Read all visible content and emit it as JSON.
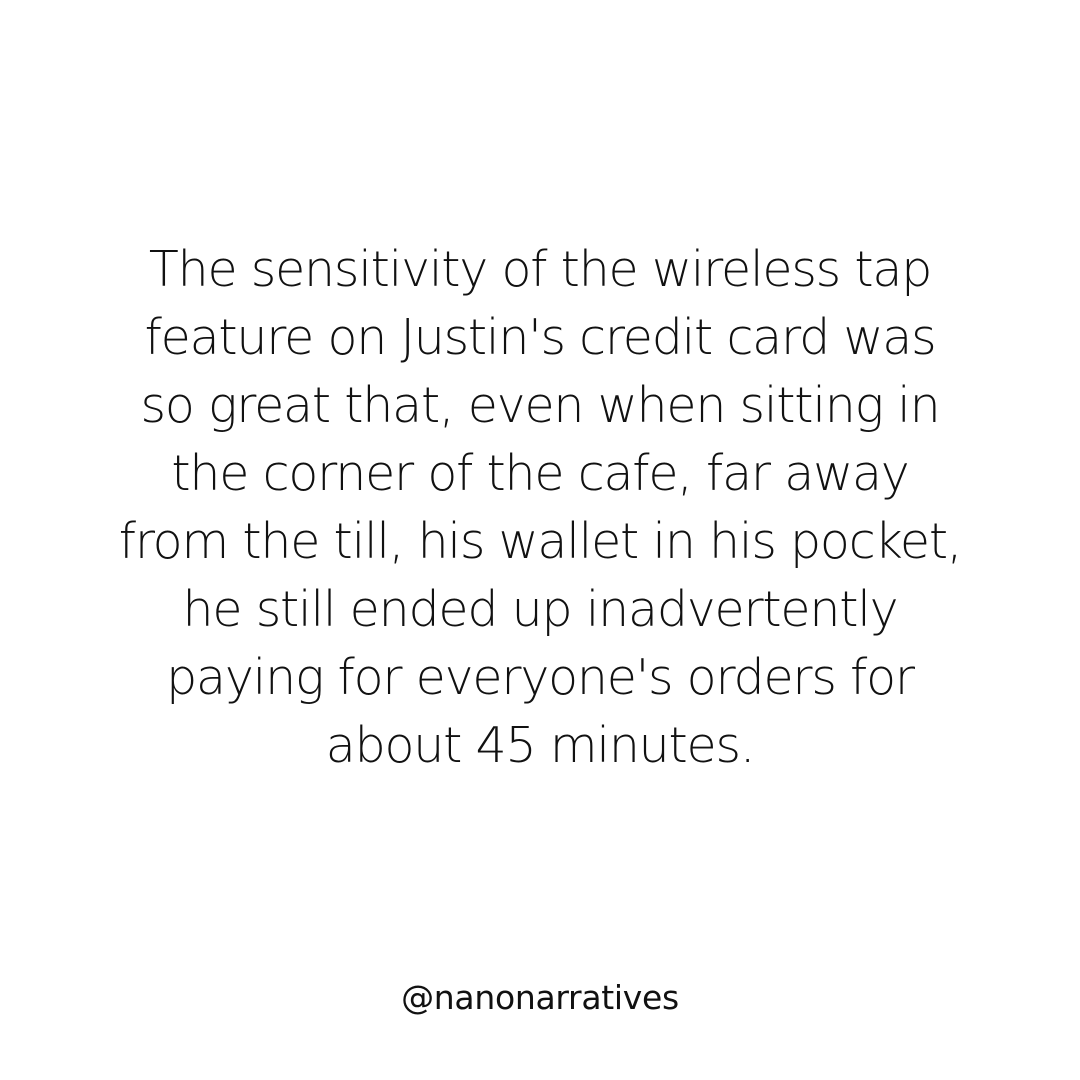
{
  "post": {
    "lines": [
      "The sensitivity of the wireless tap",
      "feature on Justin's credit card was",
      "so great that, even when sitting in",
      "the corner of the cafe, far away",
      "from the till, his wallet in his pocket,",
      "he still ended up inadvertently",
      "paying for everyone's orders for",
      "about 45 minutes."
    ],
    "handle": "@nanonarratives"
  }
}
